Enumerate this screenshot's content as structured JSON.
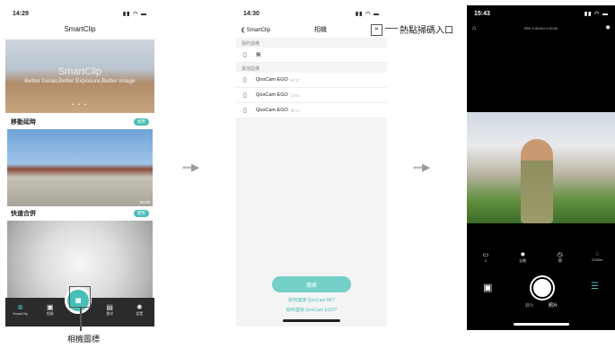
{
  "phone1": {
    "time": "14:29",
    "app_title": "SmartClip",
    "banner_title": "SmartClip",
    "banner_subtitle": "Better Detail,Better Exposure,Better Image",
    "section1": "移動延時",
    "section1_tag": "使用",
    "card1_duration": "00:30",
    "section2": "快速合併",
    "section2_tag": "使用",
    "tabs": [
      {
        "label": "SmartClip",
        "icon": "smartclip-icon"
      },
      {
        "label": "相冊",
        "icon": "album-icon"
      },
      {
        "label": "",
        "icon": "camera-icon"
      },
      {
        "label": "素材",
        "icon": "material-icon"
      },
      {
        "label": "設置",
        "icon": "gear-icon"
      }
    ]
  },
  "phone2": {
    "time": "14:30",
    "back_label": "SmartClip",
    "title": "相機",
    "my_devices": "我的設備",
    "none": "無",
    "other_devices": "其他設備",
    "devices": [
      {
        "name": "QooCam EGO",
        "suffix": "8F17"
      },
      {
        "name": "QooCam EGO",
        "suffix": "1190"
      },
      {
        "name": "QooCam EGO",
        "suffix": "8F17"
      }
    ],
    "search_button": "搜索",
    "link1": "如何連接 QooCam 8K?",
    "link2": "如何連接 QooCam EGO?"
  },
  "phone3": {
    "time": "15:43",
    "status_mid": "75%  1:00:00+1:00:00",
    "controls": [
      {
        "icon": "ratio-icon",
        "label": "3"
      },
      {
        "icon": "gear-icon",
        "label": "自動"
      },
      {
        "icon": "timer-icon",
        "label": "關"
      },
      {
        "icon": "resolution-icon",
        "label": "2000m"
      }
    ],
    "modes": [
      "錄片",
      "照片"
    ]
  },
  "callouts": {
    "camera_icon": "相機圖標",
    "scan_entry": "熱點掃碼入口"
  }
}
